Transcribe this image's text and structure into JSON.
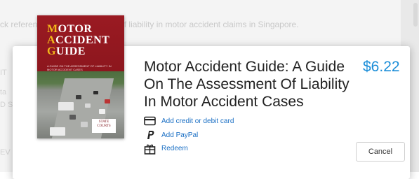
{
  "background": {
    "text": "ck reference to the assessment of liability in motor accident claims in Singapore.",
    "fragments": [
      "IT",
      "ta",
      "D S",
      "EV"
    ]
  },
  "book": {
    "cover_title_lines": [
      {
        "first": "M",
        "rest": "OTOR"
      },
      {
        "first": "A",
        "rest": "CCIDENT"
      },
      {
        "first": "G",
        "rest": "UIDE"
      }
    ],
    "cover_subtitle": "A Guide on the Assessment of Liability in Motor Accident Cases",
    "cover_seal": "STATE COURTS"
  },
  "dialog": {
    "title_lines": [
      "Motor Accident Guide: A Guide",
      "On The Assessment Of Liability",
      "In Motor Accident Cases"
    ],
    "price": "$6.22",
    "options": [
      {
        "icon": "credit-card-icon",
        "label": "Add credit or debit card"
      },
      {
        "icon": "paypal-icon",
        "label": "Add PayPal"
      },
      {
        "icon": "gift-icon",
        "label": "Redeem"
      }
    ],
    "cancel_label": "Cancel"
  },
  "colors": {
    "accent": "#1a8dd8",
    "link": "#1a6fc4",
    "cover": "#8c151d"
  }
}
